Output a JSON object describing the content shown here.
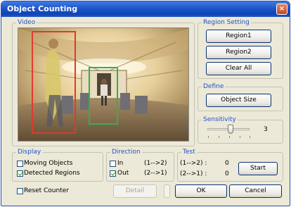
{
  "window": {
    "title": "Object Counting",
    "close_glyph": "×"
  },
  "video": {
    "label": "Video"
  },
  "region_setting": {
    "label": "Region Setting",
    "region1": "Region1",
    "region2": "Region2",
    "clear_all": "Clear All"
  },
  "define": {
    "label": "Define",
    "object_size": "Object Size"
  },
  "sensitivity": {
    "label": "Sensitivity",
    "value": "3",
    "level": 3,
    "max": 5
  },
  "display": {
    "label": "Display",
    "moving_objects": {
      "label": "Moving Objects",
      "checked": false
    },
    "detected_regions": {
      "label": "Detected Regions",
      "checked": true
    }
  },
  "direction": {
    "label": "Direction",
    "in": {
      "label": "In",
      "arrow": "(1-->2)",
      "checked": false
    },
    "out": {
      "label": "Out",
      "arrow": "(2-->1)",
      "checked": true
    }
  },
  "test": {
    "label": "Test",
    "row1": {
      "label": "(1-->2) :",
      "value": "0"
    },
    "row2": {
      "label": "(2-->1) :",
      "value": "0"
    },
    "start": "Start"
  },
  "reset_counter": {
    "label": "Reset Counter",
    "checked": false
  },
  "buttons": {
    "detail": "Detail",
    "ok": "OK",
    "cancel": "Cancel"
  },
  "colors": {
    "titlebar": "#1e56c9",
    "group_label": "#2150c6",
    "region1_box": "#e03a2e",
    "region2_box": "#2fb24a",
    "face": "#ece9d8"
  }
}
